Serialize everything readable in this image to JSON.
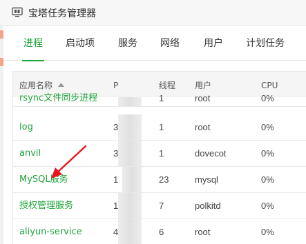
{
  "window": {
    "title": "宝塔任务管理器"
  },
  "tabs": [
    {
      "label": "进程",
      "active": true
    },
    {
      "label": "启动项",
      "active": false
    },
    {
      "label": "服务",
      "active": false
    },
    {
      "label": "网络",
      "active": false
    },
    {
      "label": "用户",
      "active": false
    },
    {
      "label": "计划任务",
      "active": false
    }
  ],
  "table": {
    "headers": {
      "name": "应用名称",
      "pid": "P",
      "threads": "线程",
      "user": "用户",
      "cpu": "CPU"
    },
    "sort_column": "name",
    "rows": [
      {
        "name": "rsync文件同步进程",
        "pid": "",
        "threads": "1",
        "user": "root",
        "cpu": "0%"
      },
      {
        "name": "log",
        "pid": "3",
        "threads": "1",
        "user": "root",
        "cpu": "0%"
      },
      {
        "name": "anvil",
        "pid": "3",
        "threads": "1",
        "user": "dovecot",
        "cpu": "0%"
      },
      {
        "name": "MySQL服务",
        "pid": "1",
        "threads": "23",
        "user": "mysql",
        "cpu": "0%"
      },
      {
        "name": "授权管理服务",
        "pid": "1",
        "threads": "7",
        "user": "polkitd",
        "cpu": "0%"
      },
      {
        "name": "aliyun-service",
        "pid": "4",
        "threads": "6",
        "user": "root",
        "cpu": "0%"
      }
    ]
  },
  "colors": {
    "accent": "#20a53a",
    "annotation_arrow": "#e8141a"
  },
  "icons": {
    "app": "task-manager-icon",
    "sort": "sort-asc-icon",
    "annotation": "red-arrow-icon"
  }
}
